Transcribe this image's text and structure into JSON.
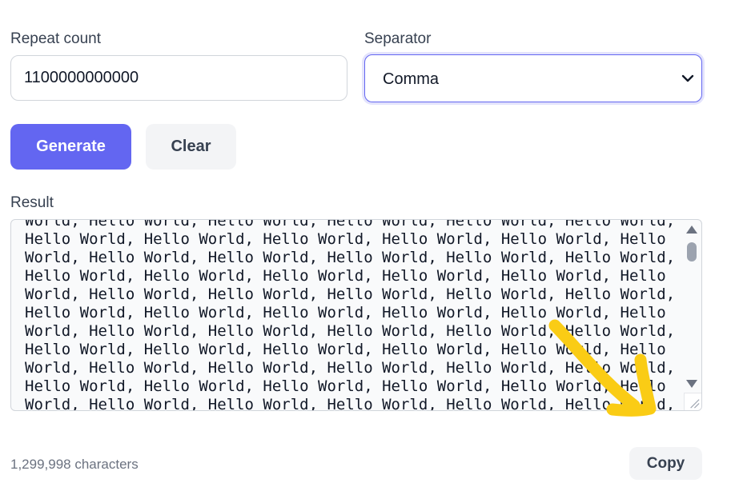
{
  "repeat": {
    "label": "Repeat count",
    "value": "1100000000000"
  },
  "separator": {
    "label": "Separator",
    "selected": "Comma"
  },
  "actions": {
    "generate_label": "Generate",
    "clear_label": "Clear"
  },
  "result": {
    "label": "Result",
    "lines": [
      "World, Hello World, Hello World, Hello World, Hello World, Hello World,",
      "Hello World, Hello World, Hello World, Hello World, Hello World, Hello",
      "World, Hello World, Hello World, Hello World, Hello World, Hello World,",
      "Hello World, Hello World, Hello World, Hello World, Hello World, Hello",
      "World, Hello World, Hello World, Hello World, Hello World, Hello World,",
      "Hello World, Hello World, Hello World, Hello World, Hello World, Hello",
      "World, Hello World, Hello World, Hello World, Hello World, Hello World,",
      "Hello World, Hello World, Hello World, Hello World, Hello World, Hello",
      "World, Hello World, Hello World, Hello World, Hello World, Hello World,",
      "Hello World, Hello World, Hello World, Hello World, Hello World, Hello",
      "World, Hello World, Hello World, Hello World, Hello World, Hello World,"
    ]
  },
  "footer": {
    "char_count": "1,299,998 characters",
    "copy_label": "Copy"
  },
  "colors": {
    "accent": "#6366f1",
    "annotation_arrow": "#facc15"
  }
}
